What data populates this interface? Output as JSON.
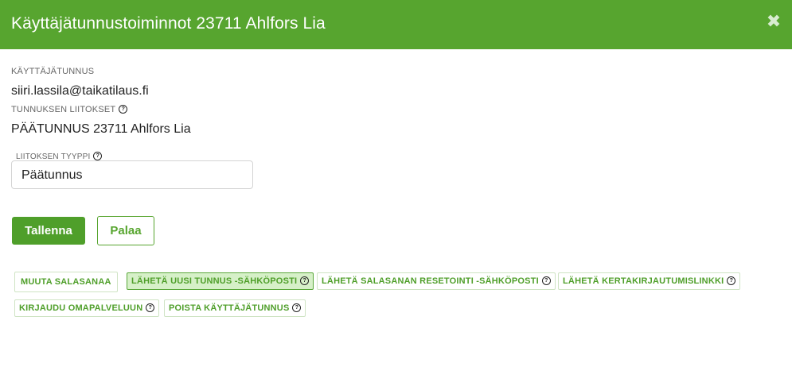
{
  "header": {
    "title": "Käyttäjätunnustoiminnot 23711 Ahlfors Lia",
    "close_glyph": "✖",
    "close_icon": "close-icon"
  },
  "form": {
    "username_label": "KÄYTTÄJÄTUNNUS",
    "username_value": "siiri.lassila@taikatilaus.fi",
    "links_label": "TUNNUKSEN LIITOKSET",
    "links_value": "PÄÄTUNNUS 23711 Ahlfors Lia",
    "link_type_label": "LIITOKSEN TYYPPI",
    "link_type_value": "Päätunnus",
    "help_glyph": "?"
  },
  "buttons": {
    "save": "Tallenna",
    "back": "Palaa"
  },
  "actions": [
    {
      "label": "MUUTA SALASANAA",
      "help": false,
      "active": false
    },
    {
      "label": "LÄHETÄ UUSI TUNNUS -SÄHKÖPOSTI",
      "help": true,
      "active": true
    },
    {
      "label": "LÄHETÄ SALASANAN RESETOINTI -SÄHKÖPOSTI",
      "help": true,
      "active": false
    },
    {
      "label": "LÄHETÄ KERTAKIRJAUTUMISLINKKI",
      "help": true,
      "active": false
    },
    {
      "label": "KIRJAUDU OMAPALVELUUN",
      "help": true,
      "active": false
    },
    {
      "label": "POISTA KÄYTTÄJÄTUNNUS",
      "help": true,
      "active": false
    }
  ],
  "colors": {
    "header_bg": "#57a52f",
    "primary": "#4f9f2a",
    "active_chip_bg": "#d6f0c8"
  }
}
